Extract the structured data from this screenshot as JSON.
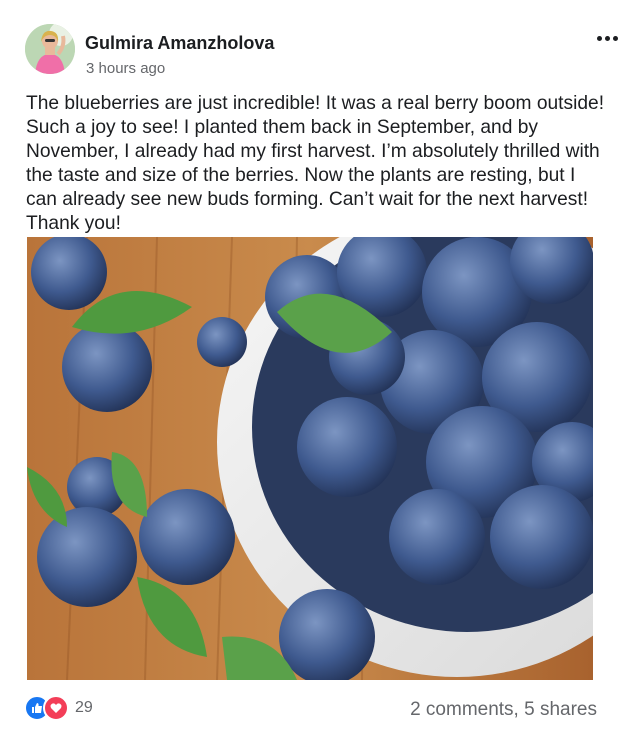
{
  "post": {
    "author": "Gulmira Amanzholova",
    "timestamp": "3 hours ago",
    "text": "The blueberries are just incredible! It was a real berry boom outside! Such a joy to see! I planted them back in September, and by November, I already had my first harvest. I’m absolutely thrilled with the taste and size of the berries. Now the plants are resting, but I can already see new buds forming. Can’t wait for the next harvest! Thank you!",
    "image_subject": "blueberries in white bowl on wooden table",
    "menu_icon": "more-options-icon"
  },
  "reactions": {
    "icons": [
      "like-icon",
      "love-icon"
    ],
    "count": "29"
  },
  "engagement": {
    "stats": "2 comments, 5 shares"
  },
  "colors": {
    "like": "#1877f2",
    "love": "#f33e58",
    "secondary_text": "#65676b"
  }
}
